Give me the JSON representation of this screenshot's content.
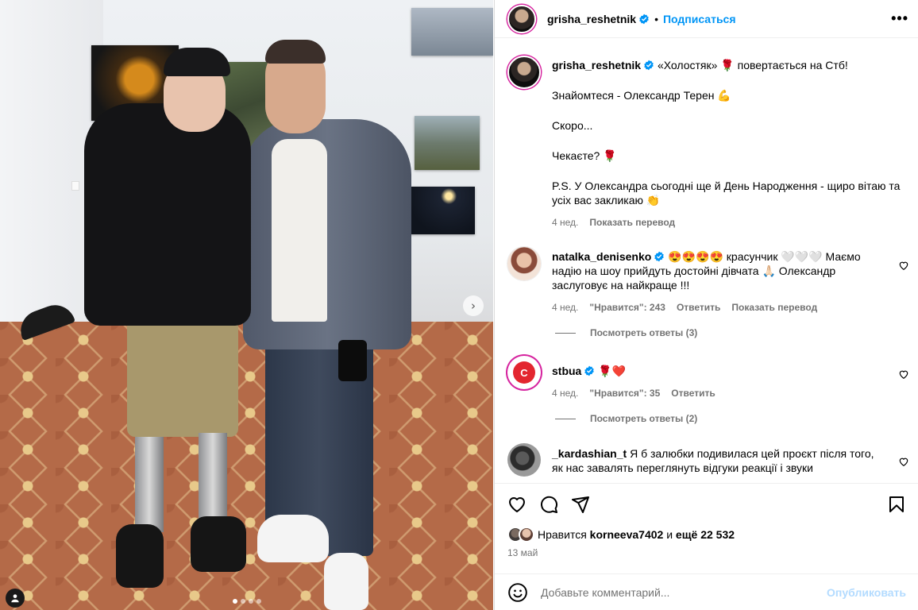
{
  "post": {
    "author": "grisha_reshetnik",
    "follow_label": "Подписаться",
    "more_label": "•••"
  },
  "caption": {
    "author": "grisha_reshetnik",
    "line1": "«Холостяк» 🌹  повертається на Стб!",
    "line2": "Знайомтеся - Олександр Терен 💪",
    "line3": "Скоро...",
    "line4": "Чекаєте? 🌹",
    "line5": "P.S. У Олександра сьогодні ще й День Народження - щиро вітаю та усіх вас закликаю 👏",
    "time": "4 нед.",
    "translate_label": "Показать перевод"
  },
  "comments": [
    {
      "author": "natalka_denisenko",
      "text": "😍😍😍😍 красунчик 🤍🤍🤍 Маємо надію на шоу прийдуть достойні дівчата 🙏🏻 Олександр заслуговує на найкраще !!!",
      "time": "4 нед.",
      "likes_label": "\"Нравится\": 243",
      "reply_label": "Ответить",
      "translate_label": "Показать перевод",
      "view_replies": "Посмотреть ответы (3)"
    },
    {
      "author": "stbua",
      "text": "🌹❤️",
      "time": "4 нед.",
      "likes_label": "\"Нравится\": 35",
      "reply_label": "Ответить",
      "view_replies": "Посмотреть ответы (2)",
      "avatar_letter": "C"
    },
    {
      "author": "_kardashian_t",
      "text": "Я б залюбки подивилася цей проєкт після того, як нас завалять переглянуть відгуки реакції і звуки"
    }
  ],
  "likes": {
    "prefix": "Нравится",
    "user": "korneeva7402",
    "middle": "и",
    "more": "ещё 22 532"
  },
  "date": "13 май",
  "composer": {
    "placeholder": "Добавьте комментарий...",
    "publish_label": "Опубликовать"
  },
  "carousel": {
    "slides": 4,
    "active_slide": 1,
    "next_arrow": "›"
  },
  "colors": {
    "accent": "#0095f6",
    "meta_text": "#737373",
    "verified": "#0095f6"
  }
}
